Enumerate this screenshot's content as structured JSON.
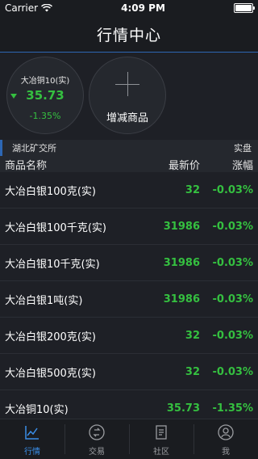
{
  "status": {
    "carrier": "Carrier",
    "time": "4:09 PM"
  },
  "nav": {
    "title": "行情中心"
  },
  "quote_card": {
    "name": "大冶铜10(实)",
    "price": "35.73",
    "change": "-1.35%"
  },
  "add_card": {
    "label": "增减商品"
  },
  "exchange": {
    "name": "湖北矿交所",
    "type": "实盘"
  },
  "columns": {
    "name": "商品名称",
    "price": "最新价",
    "change": "涨幅"
  },
  "rows": [
    {
      "name": "大冶白银100克(实)",
      "price": "32",
      "change": "-0.03%"
    },
    {
      "name": "大冶白银100千克(实)",
      "price": "31986",
      "change": "-0.03%"
    },
    {
      "name": "大冶白银10千克(实)",
      "price": "31986",
      "change": "-0.03%"
    },
    {
      "name": "大冶白银1吨(实)",
      "price": "31986",
      "change": "-0.03%"
    },
    {
      "name": "大冶白银200克(实)",
      "price": "32",
      "change": "-0.03%"
    },
    {
      "name": "大冶白银500克(实)",
      "price": "32",
      "change": "-0.03%"
    },
    {
      "name": "大冶铜10(实)",
      "price": "35.73",
      "change": "-1.35%"
    }
  ],
  "tabs": [
    {
      "label": "行情",
      "icon": "chart-icon",
      "active": true
    },
    {
      "label": "交易",
      "icon": "exchange-icon",
      "active": false
    },
    {
      "label": "社区",
      "icon": "document-icon",
      "active": false
    },
    {
      "label": "我",
      "icon": "user-icon",
      "active": false
    }
  ],
  "colors": {
    "accent": "#2d67b5",
    "up_green": "#35c040",
    "tab_active": "#3a8ee8"
  }
}
